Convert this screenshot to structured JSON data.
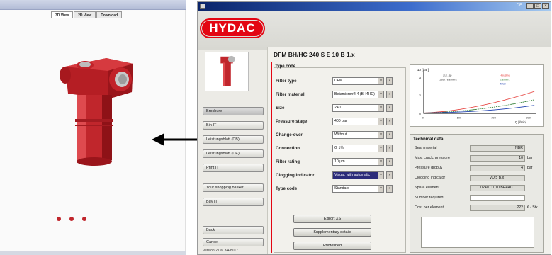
{
  "viewer": {
    "tabs": [
      "3D View",
      "2D View",
      "Download"
    ],
    "active_tab": 0,
    "product_color": "#c0262c"
  },
  "app": {
    "window_lang": "DE",
    "brand": "HYDAC",
    "brand_color": "#e30613",
    "product_title": "DFM BH/HC 240 S E 10 B 1.x",
    "nav": {
      "buttons": [
        "Brochure",
        "Bin IT",
        "Leistungsblatt (DB)",
        "Leistungsblatt (DE)",
        "Print IT",
        "Your shopping basket",
        "Buy IT",
        "Back",
        "Cancel"
      ],
      "version": "Version 2.0a, 3/4/8017"
    },
    "type_code": {
      "group_label": "Type code",
      "fields": [
        {
          "label": "Filter type",
          "value": "DFM"
        },
        {
          "label": "Filter material",
          "value": "Betamicron® 4 (BH4HC)"
        },
        {
          "label": "Size",
          "value": "240"
        },
        {
          "label": "Pressure stage",
          "value": "400 bar"
        },
        {
          "label": "Change-over",
          "value": "Without"
        },
        {
          "label": "Connection",
          "value": "G 1¼"
        },
        {
          "label": "Filter rating",
          "value": "10 µm"
        },
        {
          "label": "Clogging indicator",
          "value": "Visual, with automatic"
        },
        {
          "label": "Type code",
          "value": "Standard"
        }
      ],
      "actions": [
        "Export XS",
        "Supplementary details",
        "Predefined"
      ]
    },
    "chart": {
      "ylabel": "Δp [bar]",
      "xlabel": "Q [l/min]",
      "legend": [
        "Housing",
        "Element",
        "Total"
      ],
      "legend_left": [
        "Zul. Δp",
        "(2bar) element"
      ],
      "ticks_x": [
        "0",
        "100",
        "200",
        "300"
      ],
      "ticks_y": [
        "0",
        "2",
        "4"
      ]
    },
    "tech_data": {
      "title": "Technical data",
      "rows": [
        {
          "label": "Seal material",
          "value": "NBR",
          "unit": ""
        },
        {
          "label": "Max. crack. pressure",
          "value": "10",
          "unit": "bar"
        },
        {
          "label": "Pressure drop Δ",
          "value": "4",
          "unit": "bar"
        },
        {
          "label": "Clogging indicator",
          "value": "VD 5 B.x",
          "unit": ""
        },
        {
          "label": "Spare element",
          "value": "0240 D 010 BH4HC",
          "unit": ""
        },
        {
          "label": "Number required",
          "value": "",
          "unit": ""
        },
        {
          "label": "Cost per element",
          "value": "222",
          "unit": "€ / Stk"
        }
      ]
    }
  }
}
